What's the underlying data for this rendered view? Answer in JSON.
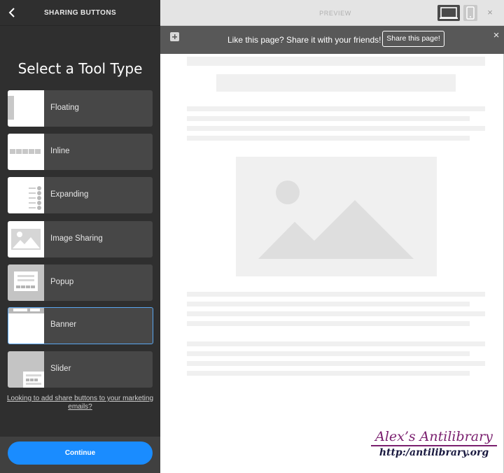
{
  "sidebar": {
    "title": "SHARING BUTTONS",
    "heading": "Select a Tool Type",
    "tools": [
      {
        "label": "Floating"
      },
      {
        "label": "Inline"
      },
      {
        "label": "Expanding"
      },
      {
        "label": "Image Sharing"
      },
      {
        "label": "Popup"
      },
      {
        "label": "Banner"
      },
      {
        "label": "Slider"
      }
    ],
    "selected_tool": "Banner",
    "email_link": "Looking to add share buttons to your marketing emails?",
    "continue_label": "Continue"
  },
  "preview": {
    "label": "PREVIEW",
    "close_glyph": "×",
    "banner": {
      "plus_glyph": "+",
      "text": "Like this page? Share it with your friends!",
      "button_label": "Share this page!",
      "close_glyph": "×"
    }
  },
  "watermark": {
    "title": "Alex’s Antilibrary",
    "url": "http:/antilibrary.org"
  },
  "colors": {
    "sidebar_bg": "#2f2f2f",
    "tool_bg": "#474747",
    "accent": "#1a8cff",
    "selected_border": "#5aa6f0",
    "banner_bg": "#585858"
  }
}
